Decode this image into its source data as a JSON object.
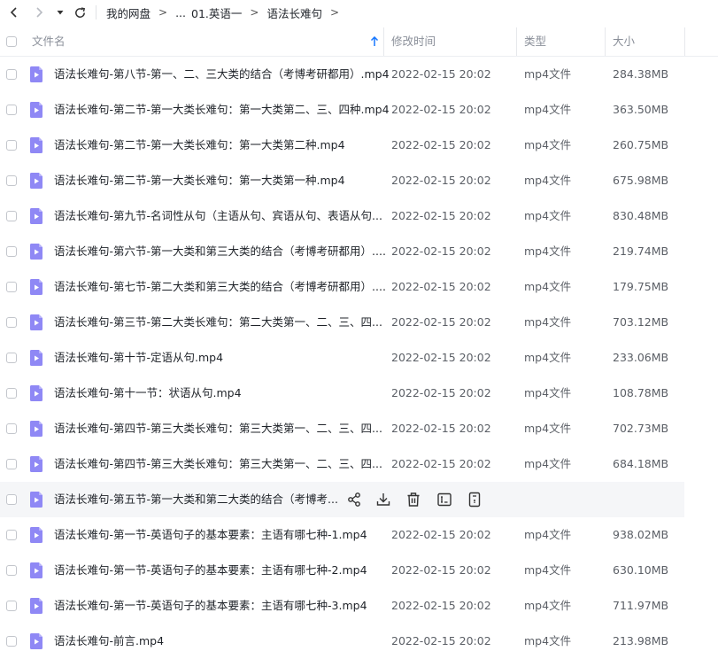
{
  "breadcrumb": {
    "root": "我的网盘",
    "ellipsis": "...",
    "parent": "01.英语一",
    "current": "语法长难句"
  },
  "columns": {
    "name": "文件名",
    "modified": "修改时间",
    "type": "类型",
    "size": "大小"
  },
  "colors": {
    "accent": "#1677ff",
    "video_icon": "#8f88f5",
    "hover_row": "#f5f6f8"
  },
  "files": [
    {
      "name": "语法长难句-第八节-第一、二、三大类的结合（考博考研都用）.mp4",
      "date": "2022-02-15 20:02",
      "type": "mp4文件",
      "size": "284.38MB"
    },
    {
      "name": "语法长难句-第二节-第一大类长难句：第一大类第二、三、四种.mp4",
      "date": "2022-02-15 20:02",
      "type": "mp4文件",
      "size": "363.50MB"
    },
    {
      "name": "语法长难句-第二节-第一大类长难句：第一大类第二种.mp4",
      "date": "2022-02-15 20:02",
      "type": "mp4文件",
      "size": "260.75MB"
    },
    {
      "name": "语法长难句-第二节-第一大类长难句：第一大类第一种.mp4",
      "date": "2022-02-15 20:02",
      "type": "mp4文件",
      "size": "675.98MB"
    },
    {
      "name": "语法长难句-第九节-名词性从句（主语从句、宾语从句、表语从句...",
      "date": "2022-02-15 20:02",
      "type": "mp4文件",
      "size": "830.48MB"
    },
    {
      "name": "语法长难句-第六节-第一大类和第三大类的结合（考博考研都用）....",
      "date": "2022-02-15 20:02",
      "type": "mp4文件",
      "size": "219.74MB"
    },
    {
      "name": "语法长难句-第七节-第二大类和第三大类的结合（考博考研都用）....",
      "date": "2022-02-15 20:02",
      "type": "mp4文件",
      "size": "179.75MB"
    },
    {
      "name": "语法长难句-第三节-第二大类长难句：第二大类第一、二、三、四...",
      "date": "2022-02-15 20:02",
      "type": "mp4文件",
      "size": "703.12MB"
    },
    {
      "name": "语法长难句-第十节-定语从句.mp4",
      "date": "2022-02-15 20:02",
      "type": "mp4文件",
      "size": "233.06MB"
    },
    {
      "name": "语法长难句-第十一节：状语从句.mp4",
      "date": "2022-02-15 20:02",
      "type": "mp4文件",
      "size": "108.78MB"
    },
    {
      "name": "语法长难句-第四节-第三大类长难句：第三大类第一、二、三、四...",
      "date": "2022-02-15 20:02",
      "type": "mp4文件",
      "size": "702.73MB"
    },
    {
      "name": "语法长难句-第四节-第三大类长难句：第三大类第一、二、三、四...",
      "date": "2022-02-15 20:02",
      "type": "mp4文件",
      "size": "684.18MB"
    },
    {
      "name": "语法长难句-第五节-第一大类和第二大类的结合（考博考...",
      "date": "",
      "type": "",
      "size": "",
      "hover": true
    },
    {
      "name": "语法长难句-第一节-英语句子的基本要素：主语有哪七种-1.mp4",
      "date": "2022-02-15 20:02",
      "type": "mp4文件",
      "size": "938.02MB"
    },
    {
      "name": "语法长难句-第一节-英语句子的基本要素：主语有哪七种-2.mp4",
      "date": "2022-02-15 20:02",
      "type": "mp4文件",
      "size": "630.10MB"
    },
    {
      "name": "语法长难句-第一节-英语句子的基本要素：主语有哪七种-3.mp4",
      "date": "2022-02-15 20:02",
      "type": "mp4文件",
      "size": "711.97MB"
    },
    {
      "name": "语法长难句-前言.mp4",
      "date": "2022-02-15 20:02",
      "type": "mp4文件",
      "size": "213.98MB"
    }
  ]
}
